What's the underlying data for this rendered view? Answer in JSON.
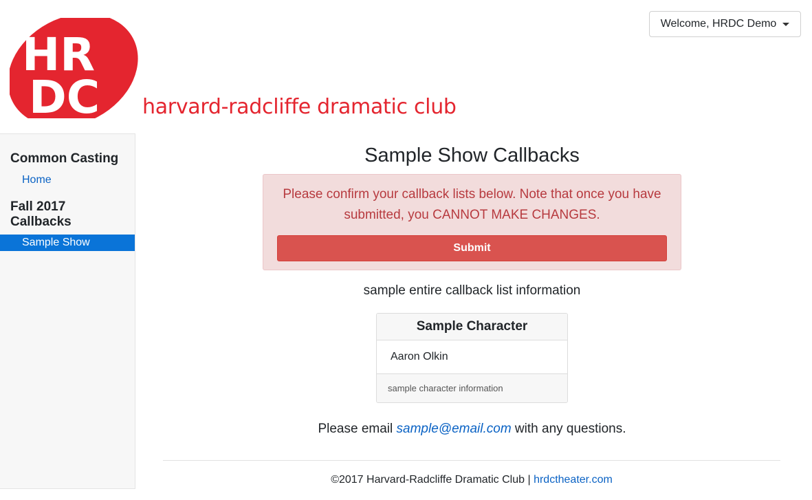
{
  "header": {
    "logo_letters_top": "HR",
    "logo_letters_bottom": "DC",
    "logo_text": "harvard-radcliffe dramatic club",
    "brand_color": "#e4252f",
    "user_menu_label": "Welcome, HRDC Demo"
  },
  "sidebar": {
    "section1_title": "Common Casting",
    "home_label": "Home",
    "section2_title": "Fall 2017 Callbacks",
    "active_item_label": "Sample Show",
    "active_color": "#0a74d8"
  },
  "main": {
    "title": "Sample Show Callbacks",
    "alert_text": "Please confirm your callback lists below. Note that once you have submitted, you CANNOT MAKE CHANGES.",
    "submit_label": "Submit",
    "list_info": "sample entire callback list information",
    "card": {
      "header": "Sample Character",
      "actor": "Aaron Olkin",
      "footer": "sample character information"
    },
    "contact_prefix": "Please email ",
    "contact_email": "sample@email.com",
    "contact_suffix": " with any questions."
  },
  "footer": {
    "copyright": "©2017 Harvard-Radcliffe Dramatic Club | ",
    "link_text": "hrdctheater.com"
  }
}
